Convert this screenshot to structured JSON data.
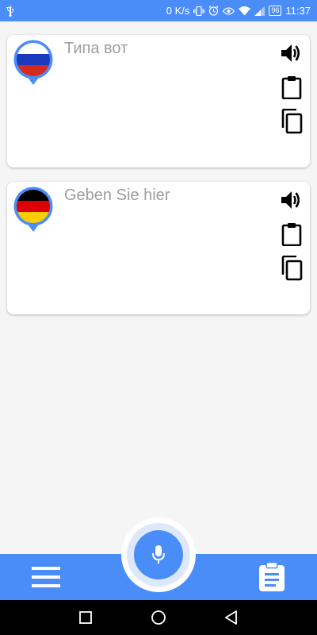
{
  "status_bar": {
    "speed": "0 K/s",
    "battery": "96",
    "time": "11:37"
  },
  "cards": {
    "source": {
      "text": "Типа вот",
      "flag": "russia-flag"
    },
    "target": {
      "text": "Geben Sie hier",
      "flag": "germany-flag"
    }
  },
  "icons": {
    "speaker": "speaker-icon",
    "paste": "clipboard-icon",
    "copy": "copy-icon",
    "mic": "microphone-icon",
    "menu": "hamburger-menu-icon",
    "history": "clipboard-list-icon"
  },
  "colors": {
    "accent": "#4b8df8",
    "text_placeholder": "#9e9e9e"
  }
}
